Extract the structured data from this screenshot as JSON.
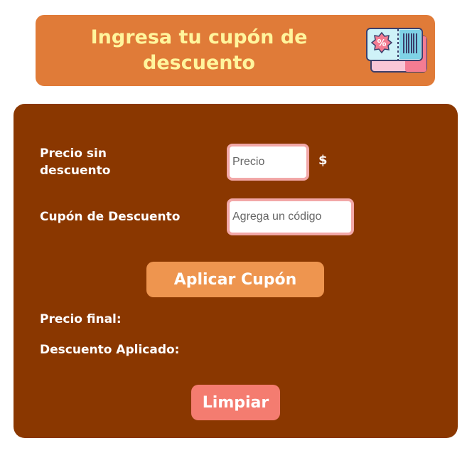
{
  "header": {
    "title": "Ingresa tu cupón de descuento",
    "icon": "coupon-ticket-icon"
  },
  "form": {
    "price_label": "Precio sin descuento",
    "price_placeholder": "Precio",
    "currency_symbol": "$",
    "coupon_label": "Cupón de Descuento",
    "coupon_placeholder": "Agrega un código",
    "apply_button": "Aplicar Cupón",
    "final_price_label": "Precio final:",
    "discount_label": "Descuento Aplicado:",
    "clear_button": "Limpiar"
  },
  "colors": {
    "header_bg": "#E07B38",
    "header_text": "#FFF59D",
    "card_bg": "#8A3700",
    "input_border": "#F2A7A7",
    "apply_bg": "#EE954F",
    "clear_bg": "#F47C70"
  }
}
